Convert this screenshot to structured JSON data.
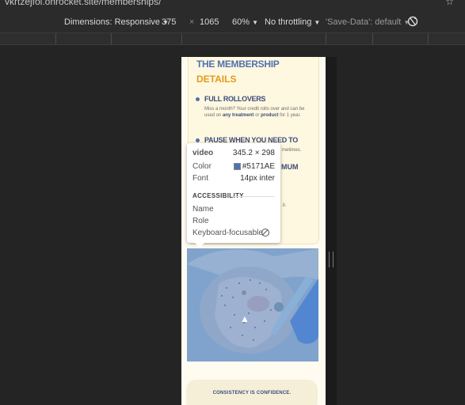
{
  "browser": {
    "url": "vkrtzejfol.onrocket.site/memberships/",
    "star_icon": "star-icon"
  },
  "device_toolbar": {
    "dimensions_label": "Dimensions: Responsive",
    "width": "375",
    "times": "×",
    "height": "1065",
    "zoom": "60%",
    "throttling": "No throttling",
    "save_data": "'Save-Data': default",
    "dropdown_arrow": "▼"
  },
  "page": {
    "heading_line1": "THE MEMBERSHIP",
    "heading_line2": "DETAILS",
    "items": [
      {
        "title": "FULL ROLLOVERS",
        "desc_pre": "Miss a month? Your credit rolls over and can be used on",
        "desc_b1": "any treatment",
        "desc_mid": "or",
        "desc_b2": "product",
        "desc_post": "for 1 year."
      },
      {
        "title": "PAUSE WHEN YOU NEED TO"
      }
    ],
    "partial_text_1": "metimes.",
    "partial_text_2": "MUM",
    "partial_text_3": "il.",
    "bottom_text": "CONSISTENCY IS CONFIDENCE."
  },
  "tooltip": {
    "tag": "video",
    "size": "345.2 × 298",
    "color_label": "Color",
    "color_value": "#5171AE",
    "font_label": "Font",
    "font_value": "14px inter",
    "accessibility_heading": "ACCESSIBILITY",
    "name_label": "Name",
    "role_label": "Role",
    "keyboard_label": "Keyboard-focusable"
  },
  "colors": {
    "brand_blue": "#5171ae",
    "brand_orange": "#e39a1b",
    "page_bg": "#fffbf0"
  }
}
